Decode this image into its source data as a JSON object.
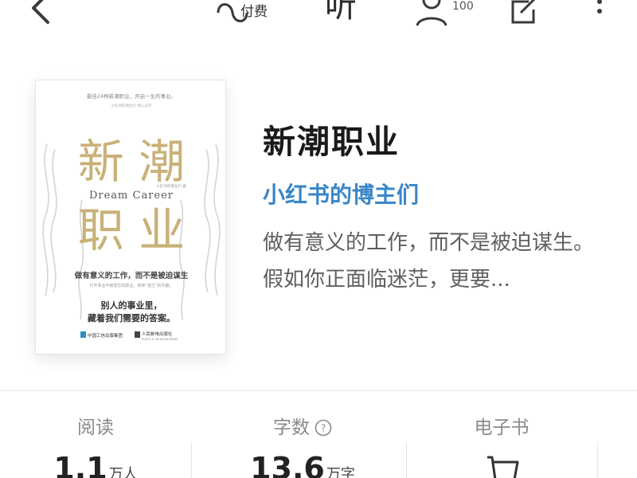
{
  "toolbar": {
    "paid_label": "付费",
    "listen_label": "听",
    "reader_count": "100"
  },
  "book": {
    "title": "新潮职业",
    "author": "小红书的博主们",
    "description": "做有意义的工作，而不是被迫谋生。假如你正面临迷茫，更要..."
  },
  "cover": {
    "top_line": "最佳24种新潮职业，开启一生的事业。",
    "top_line_small": "小红书的博主们 倾心分享",
    "title_line1": "新 潮",
    "title_line2": "职 业",
    "subtitle_en": "Dream Career",
    "small_author": "小红书的博主们 著",
    "slogan": "做有意义的工作，而不是被迫谋生",
    "slogan_small": "打开事业中被遗忘的职业，体味“自己”的乐趣。",
    "tagline_1": "别人的事业里，",
    "tagline_2": "藏着我们需要的答案。",
    "publisher_1": "中国工信出版集团",
    "publisher_2": "人民邮电出版社",
    "publisher_2_en": "POSTS & TELECOM PRESS",
    "accent_color": "#c9b178"
  },
  "stats": {
    "read_label": "阅读",
    "read_value": "1.1",
    "read_unit": "万人",
    "words_label": "字数",
    "words_value": "13.6",
    "words_unit": "万字",
    "ebook_label": "电子书"
  },
  "colors": {
    "author_link": "#3a86c8",
    "muted_text": "#8a8a8a"
  }
}
